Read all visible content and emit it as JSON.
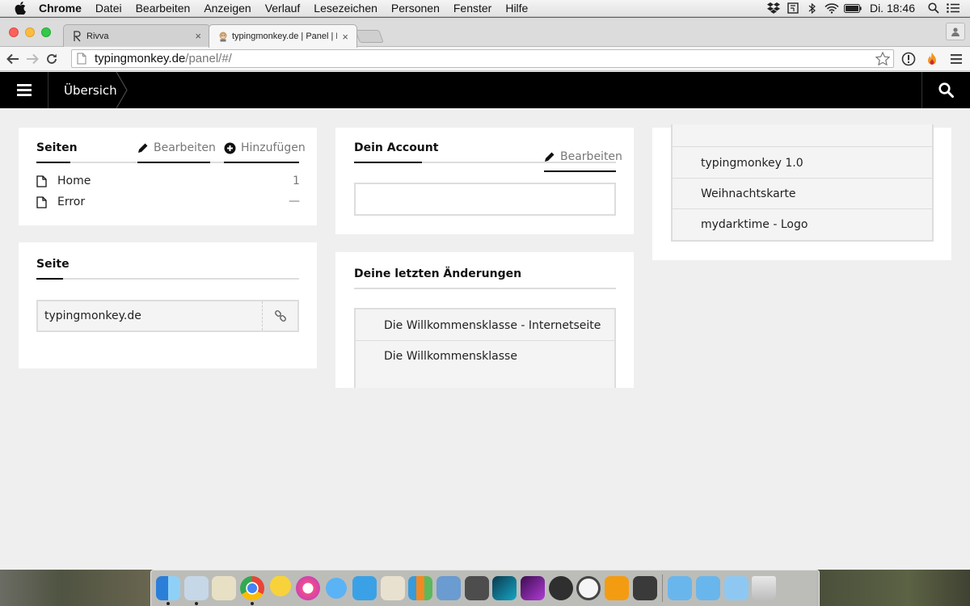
{
  "menubar": {
    "app": "Chrome",
    "items": [
      "Datei",
      "Bearbeiten",
      "Anzeigen",
      "Verlauf",
      "Lesezeichen",
      "Personen",
      "Fenster",
      "Hilfe"
    ],
    "clock": "Di. 18:46"
  },
  "tabs": [
    {
      "title": "Rivva",
      "favicon": "rivva-icon"
    },
    {
      "title": "typingmonkey.de | Panel | K",
      "favicon": "monkey-icon",
      "active": true
    }
  ],
  "omnibox": {
    "host": "typingmonkey.de",
    "path": "/panel/#/"
  },
  "panel": {
    "breadcrumb": "Übersicht",
    "seiten": {
      "title": "Seiten",
      "edit": "Bearbeiten",
      "add": "Hinzufügen",
      "pages": [
        {
          "name": "Home",
          "value": "1"
        },
        {
          "name": "Error",
          "value": "—"
        }
      ]
    },
    "seite": {
      "title": "Seite",
      "url": "typingmonkey.de"
    },
    "account": {
      "title": "Dein Account",
      "edit": "Bearbeiten"
    },
    "changes": {
      "title": "Deine letzten Änderungen",
      "items": [
        "Die Willkommensklasse - Internetseite",
        "Die Willkommensklasse"
      ]
    },
    "projects": {
      "items": [
        "typingmonkey 1.0",
        "Weihnachtskarte",
        "mydarktime - Logo"
      ]
    }
  },
  "colors": {
    "topbar": "#000000",
    "background": "#efefef",
    "card": "#ffffff",
    "muted": "#777777"
  }
}
